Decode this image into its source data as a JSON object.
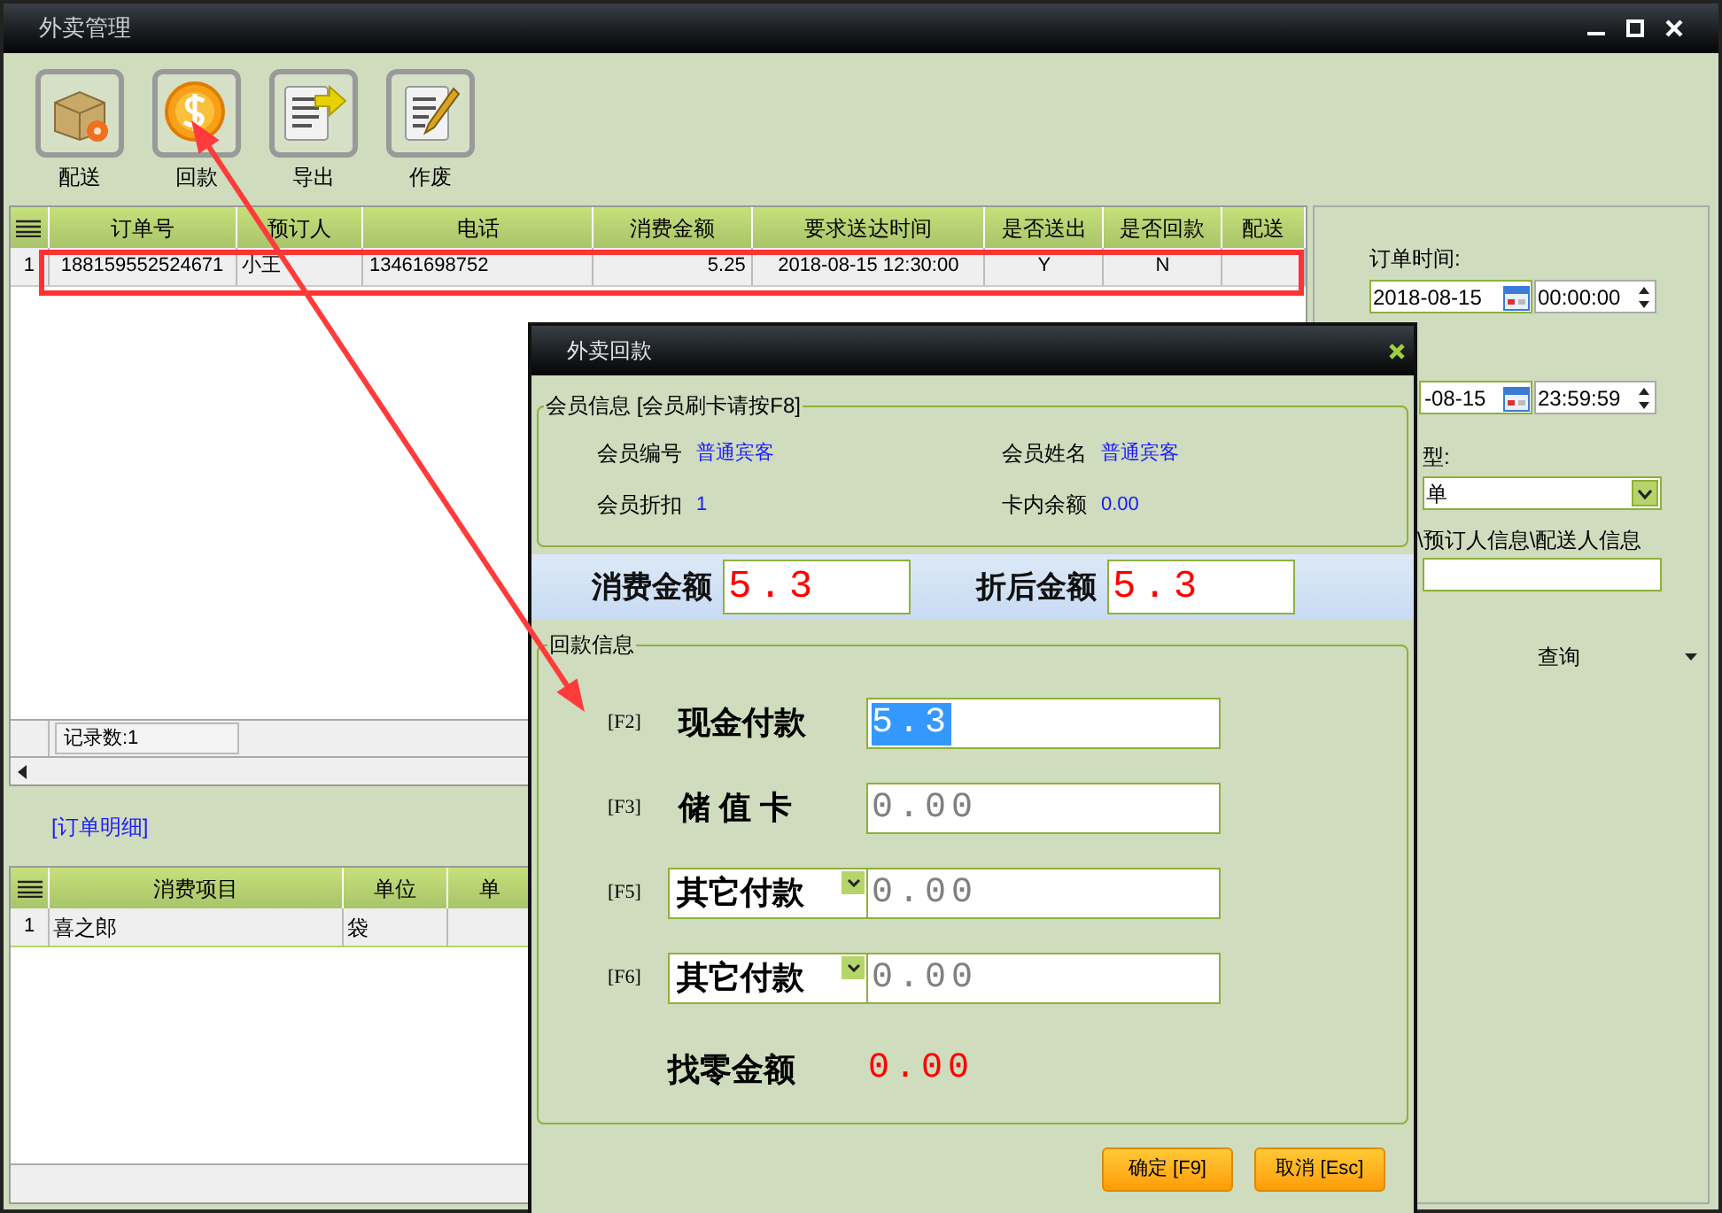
{
  "window": {
    "title": "外卖管理"
  },
  "toolbar": [
    {
      "label": "配送",
      "kind": "box"
    },
    {
      "label": "回款",
      "kind": "coin"
    },
    {
      "label": "导出",
      "kind": "export"
    },
    {
      "label": "作废",
      "kind": "void"
    }
  ],
  "orders": {
    "columns": [
      "订单号",
      "预订人",
      "电话",
      "消费金额",
      "要求送达时间",
      "是否送出",
      "是否回款",
      "配送"
    ],
    "rows": [
      {
        "index": "1",
        "cells": [
          "188159552524671",
          "小王",
          "13461698752",
          "5.25",
          "2018-08-15 12:30:00",
          "Y",
          "N",
          ""
        ]
      }
    ],
    "footer": "记录数:1"
  },
  "detail": {
    "title": "[订单明细]",
    "columns": [
      "消费项目",
      "单位",
      "单"
    ],
    "rows": [
      {
        "index": "1",
        "cells": [
          "喜之郎",
          "袋",
          ""
        ]
      }
    ]
  },
  "filters": {
    "order_time_label": "订单时间:",
    "start_date": "2018-08-15",
    "start_time": "00:00:00",
    "end_date": "-08-15",
    "end_time": "23:59:59",
    "type_label": "型:",
    "type_value": "单",
    "search_label": "\\预订人信息\\配送人信息",
    "query_button": "查询"
  },
  "dialog": {
    "title": "外卖回款",
    "member_group": "会员信息 [会员刷卡请按F8]",
    "member_fields": [
      {
        "label": "会员编号",
        "value": "普通宾客"
      },
      {
        "label": "会员姓名",
        "value": "普通宾客"
      },
      {
        "label": "会员折扣",
        "value": "1"
      },
      {
        "label": "卡内余额",
        "value": "0.00"
      }
    ],
    "totals": [
      {
        "label": "消费金额",
        "value": "5.3"
      },
      {
        "label": "折后金额",
        "value": "5.3"
      }
    ],
    "payment_group": "回款信息",
    "payments": [
      {
        "key": "[F2]",
        "kind": "label",
        "label": "现金付款",
        "value": "5.3",
        "selected": true
      },
      {
        "key": "[F3]",
        "kind": "label",
        "label": "储 值 卡",
        "value": "0.00",
        "selected": false
      },
      {
        "key": "[F5]",
        "kind": "dropdown",
        "label": "其它付款",
        "value": "0.00",
        "selected": false
      },
      {
        "key": "[F6]",
        "kind": "dropdown",
        "label": "其它付款",
        "value": "0.00",
        "selected": false
      }
    ],
    "change": {
      "label": "找零金额",
      "value": "0.00"
    },
    "buttons": [
      "确定 [F9]",
      "取消 [Esc]"
    ]
  }
}
